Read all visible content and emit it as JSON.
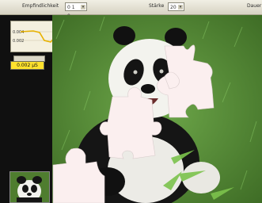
{
  "toolbar": {
    "sensitivity_label": "Empfindlichkeit",
    "sensitivity_value": "0 1 0",
    "strength_label": "Stärke",
    "strength_value": "20",
    "duration_label": "Dauer",
    "arrow_glyph": "▾"
  },
  "sidebar": {
    "graph_ticks": [
      "0.004",
      "0.002"
    ],
    "value_display": "0.002 µS"
  },
  "colors": {
    "sidebar": "#101010",
    "value_box": "#ffe22d",
    "graph_line": "#e8b200",
    "puzzle_piece": "#fbefef"
  },
  "puzzle": {
    "pieces_visible": 4
  }
}
